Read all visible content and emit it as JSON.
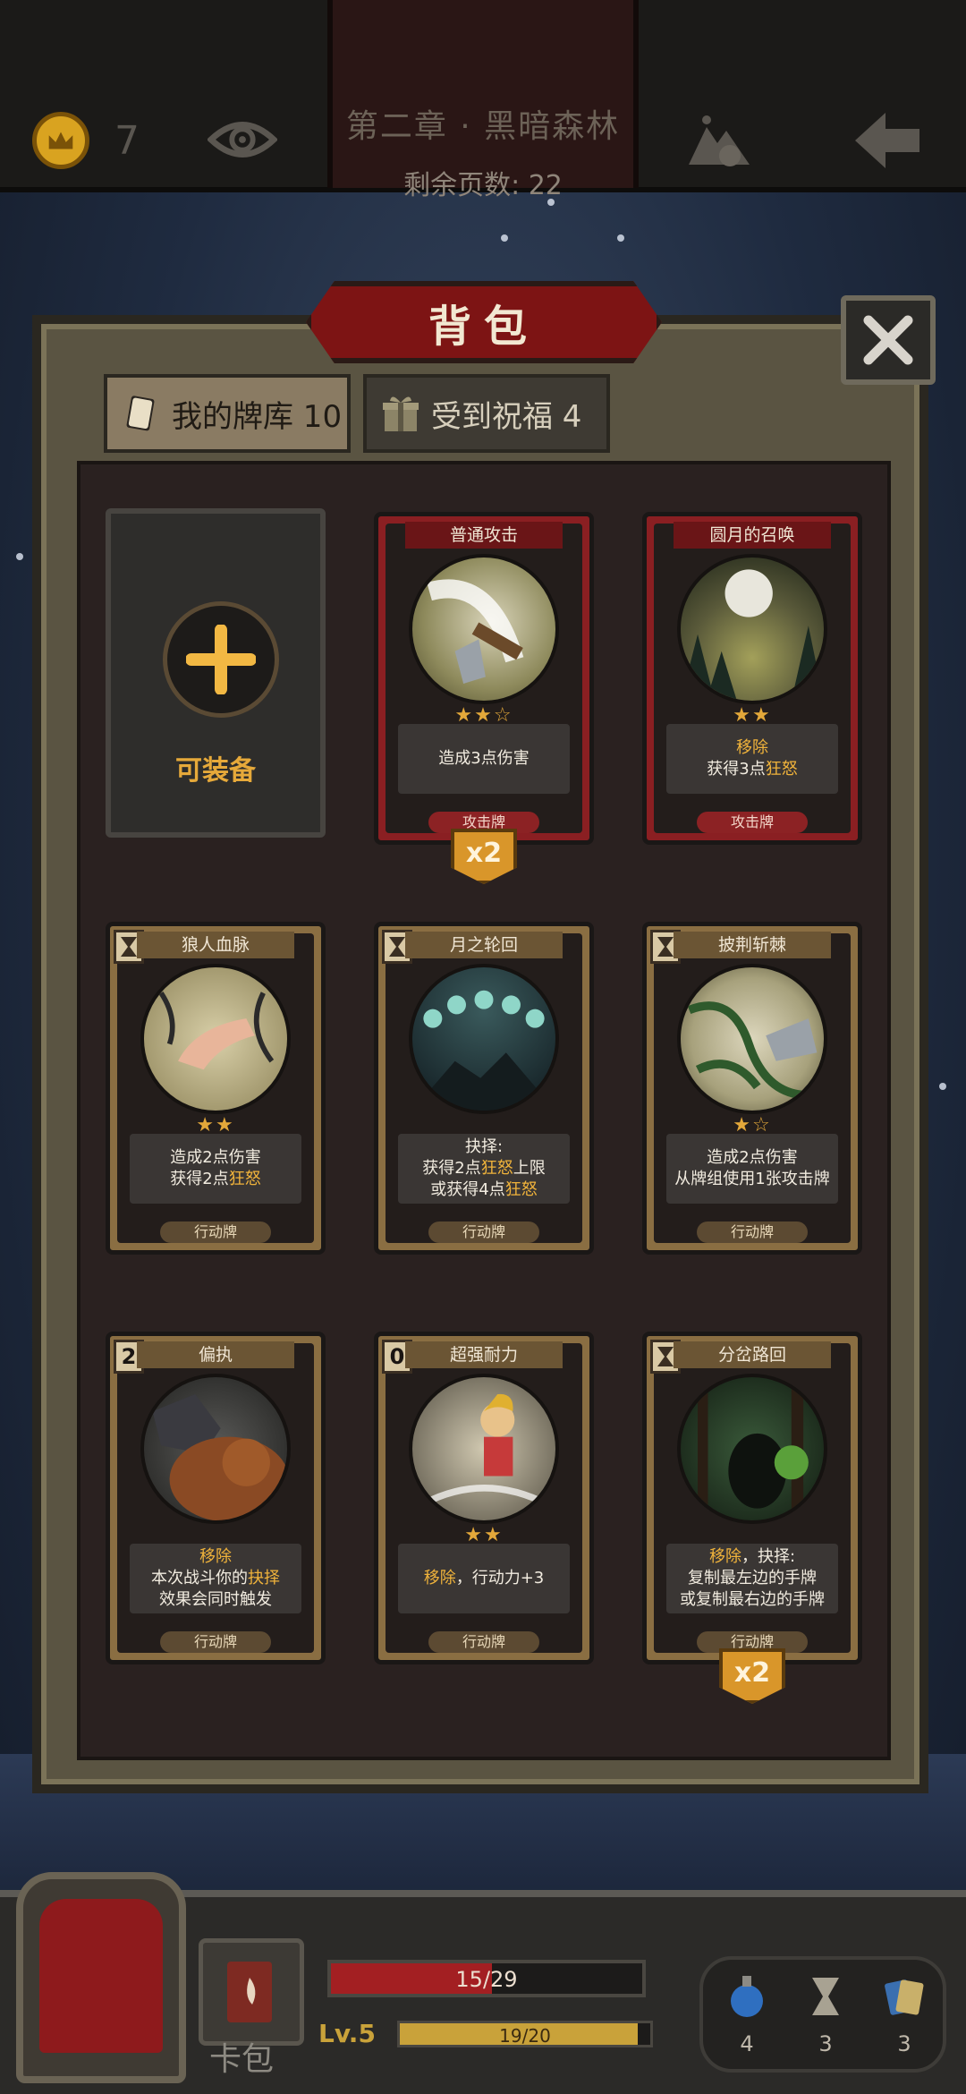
{
  "header": {
    "coins": "7",
    "chapter_title": "第二章 · 黑暗森林",
    "pages_left": "剩余页数: 22",
    "icons": [
      "crown-coin-icon",
      "eye-icon",
      "mountain-pumpkin-icon",
      "back-arrow-icon"
    ]
  },
  "panel": {
    "title": "背包",
    "tabs": [
      {
        "label": "我的牌库 10",
        "icon": "card-icon",
        "active": true
      },
      {
        "label": "受到祝福 4",
        "icon": "gift-icon",
        "active": false
      }
    ],
    "equip_slot_label": "可装备"
  },
  "cards": [
    {
      "name": "普通攻击",
      "kind": "attack",
      "cost": "",
      "stars": "★★☆",
      "desc": [
        "造成3点伤害"
      ],
      "type": "攻击牌",
      "dup": "x2"
    },
    {
      "name": "圆月的召唤",
      "kind": "attack",
      "cost": "",
      "stars": "★★",
      "desc": [
        "移除",
        "获得3点狂怒"
      ],
      "type": "攻击牌",
      "dup": ""
    },
    {
      "name": "狼人血脉",
      "kind": "action",
      "cost": "hourglass",
      "stars": "★★",
      "desc": [
        "造成2点伤害",
        "获得2点狂怒"
      ],
      "type": "行动牌",
      "dup": ""
    },
    {
      "name": "月之轮回",
      "kind": "action",
      "cost": "hourglass",
      "stars": "",
      "desc": [
        "抉择:",
        "获得2点狂怒上限",
        "或获得4点狂怒"
      ],
      "type": "行动牌",
      "dup": ""
    },
    {
      "name": "披荆斩棘",
      "kind": "action",
      "cost": "hourglass",
      "stars": "★☆",
      "desc": [
        "造成2点伤害",
        "从牌组使用1张攻击牌"
      ],
      "type": "行动牌",
      "dup": ""
    },
    {
      "name": "偏执",
      "kind": "action",
      "cost": "2",
      "stars": "",
      "desc": [
        "移除",
        "本次战斗你的抉择",
        "效果会同时触发"
      ],
      "type": "行动牌",
      "dup": ""
    },
    {
      "name": "超强耐力",
      "kind": "action",
      "cost": "0",
      "stars": "★★",
      "desc": [
        "移除，行动力+3"
      ],
      "type": "行动牌",
      "dup": ""
    },
    {
      "name": "分岔路回",
      "kind": "action",
      "cost": "hourglass",
      "stars": "",
      "desc": [
        "移除，抉择:",
        "复制最左边的手牌",
        "或复制最右边的手牌"
      ],
      "type": "行动牌",
      "dup": "x2"
    }
  ],
  "hud": {
    "card_pack_label": "卡包",
    "hp_text": "15/29",
    "hp_fraction": 0.517,
    "level": "Lv.5",
    "xp_text": "19/20",
    "xp_fraction": 0.95,
    "resources": [
      {
        "icon": "potion-icon",
        "count": "4"
      },
      {
        "icon": "hourglass-icon",
        "count": "3"
      },
      {
        "icon": "cards-icon",
        "count": "3"
      }
    ]
  },
  "colors": {
    "attack_card": "#8a1f22",
    "action_card": "#8a6e42",
    "highlight": "#f0b33b",
    "gold": "#d9a320"
  }
}
